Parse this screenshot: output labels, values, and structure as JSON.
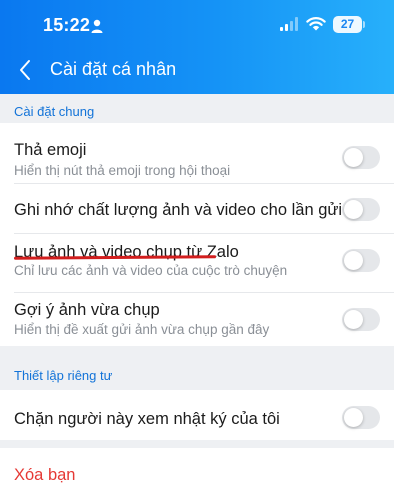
{
  "status_bar": {
    "time": "15:22",
    "battery": "27"
  },
  "header": {
    "title": "Cài đặt cá nhân"
  },
  "sections": {
    "general": {
      "label": "Cài đặt chung",
      "items": [
        {
          "title": "Thả emoji",
          "subtitle": "Hiển thị nút thả emoji trong hội thoại",
          "enabled": false
        },
        {
          "title": "Ghi nhớ chất lượng ảnh và video cho lần gửi sau",
          "enabled": false
        },
        {
          "title": "Lưu ảnh và video chụp từ Zalo",
          "subtitle": "Chỉ lưu các ảnh và video của cuộc trò chuyện",
          "enabled": false
        },
        {
          "title": "Gợi ý ảnh vừa chụp",
          "subtitle": "Hiển thị đề xuất gửi ảnh vừa chụp gần đây",
          "enabled": false
        }
      ]
    },
    "privacy": {
      "label": "Thiết lập riêng tư",
      "items": [
        {
          "title": "Chặn người này xem nhật ký của tôi",
          "enabled": false
        }
      ]
    }
  },
  "actions": {
    "remove_friend": "Xóa bạn"
  },
  "colors": {
    "accent": "#1273d8",
    "danger": "#e53935",
    "header_start": "#0a78f0",
    "header_end": "#27b0fb"
  }
}
